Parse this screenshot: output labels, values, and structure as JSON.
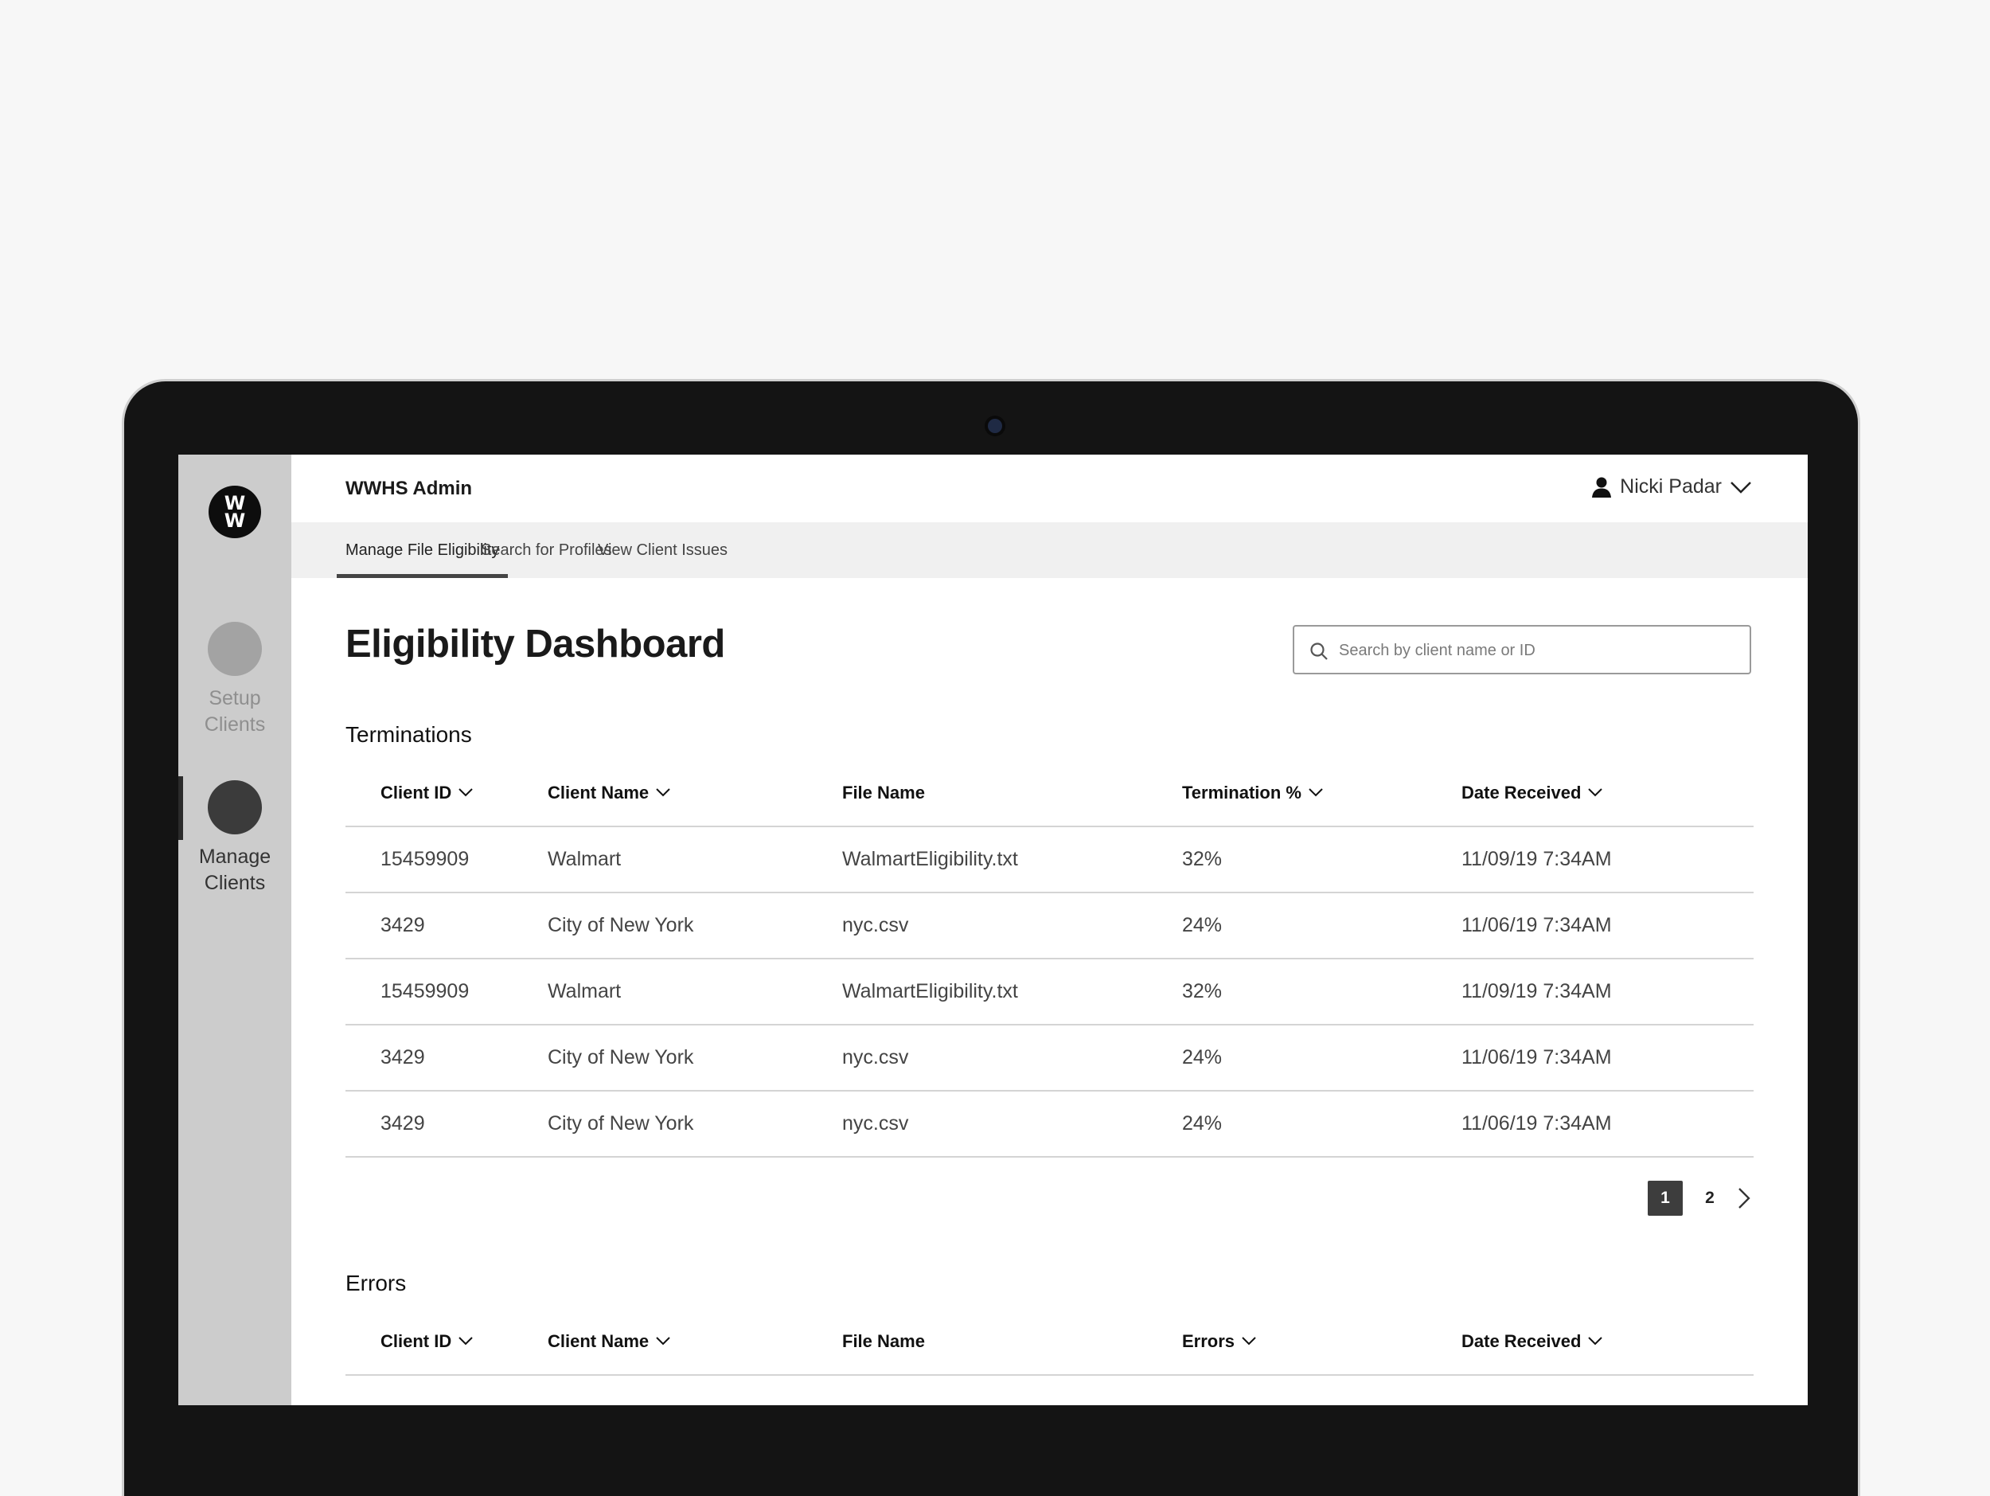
{
  "app": {
    "title": "WWHS Admin",
    "logo_text": [
      "W",
      "W"
    ]
  },
  "user": {
    "name": "Nicki Padar"
  },
  "sidebar": {
    "items": [
      {
        "label": "Setup Clients",
        "active": false
      },
      {
        "label": "Manage Clients",
        "active": true
      }
    ]
  },
  "tabs": [
    {
      "label": "Manage File Eligibility",
      "active": true
    },
    {
      "label": "Search for Profiles",
      "active": false
    },
    {
      "label": "View Client Issues",
      "active": false
    }
  ],
  "page": {
    "title": "Eligibility Dashboard"
  },
  "search": {
    "placeholder": "Search by client name or ID",
    "value": ""
  },
  "terminations": {
    "title": "Terminations",
    "columns": [
      "Client ID",
      "Client Name",
      "File Name",
      "Termination %",
      "Date Received"
    ],
    "rows": [
      [
        "15459909",
        "Walmart",
        "WalmartEligibility.txt",
        "32%",
        "11/09/19 7:34AM"
      ],
      [
        "3429",
        "City of New York",
        "nyc.csv",
        "24%",
        "11/06/19 7:34AM"
      ],
      [
        "15459909",
        "Walmart",
        "WalmartEligibility.txt",
        "32%",
        "11/09/19 7:34AM"
      ],
      [
        "3429",
        "City of New York",
        "nyc.csv",
        "24%",
        "11/06/19 7:34AM"
      ],
      [
        "3429",
        "City of New York",
        "nyc.csv",
        "24%",
        "11/06/19 7:34AM"
      ]
    ]
  },
  "pagination": {
    "current": "1",
    "next_page": "2"
  },
  "errors": {
    "title": "Errors",
    "columns": [
      "Client ID",
      "Client Name",
      "File Name",
      "Errors",
      "Date Received"
    ]
  }
}
